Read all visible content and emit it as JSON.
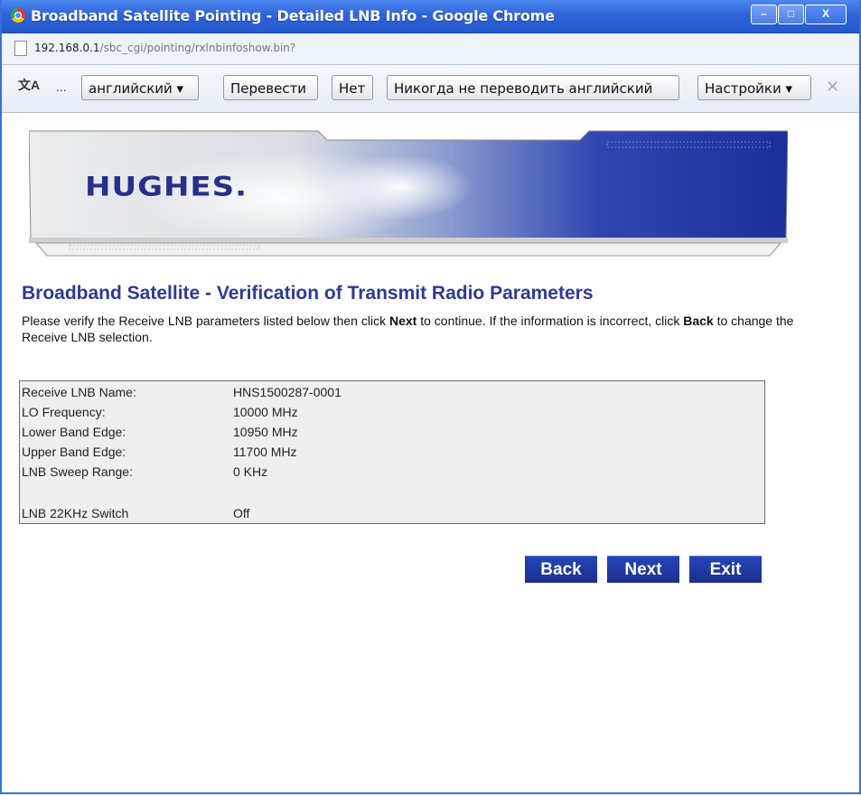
{
  "window": {
    "title": "Broadband Satellite Pointing - Detailed LNB Info - Google Chrome",
    "minimize_glyph": "–",
    "maximize_glyph": "□",
    "close_glyph": "X"
  },
  "address": {
    "host": "192.168.0.1",
    "path": "/sbc_cgi/pointing/rxlnbinfoshow.bin?"
  },
  "translate_bar": {
    "icon_text": "文A",
    "ellipsis": "...",
    "language_label": "английский ▾",
    "translate_label": "Перевести",
    "no_label": "Нет",
    "never_label": "Никогда не переводить английский",
    "settings_label": "Настройки ▾",
    "close_glyph": "✕"
  },
  "banner": {
    "logo_text": "HUGHES."
  },
  "page": {
    "title": "Broadband Satellite - Verification of Transmit Radio Parameters",
    "instructions": {
      "part1": "Please verify the Receive LNB parameters listed below then click ",
      "next_word": "Next",
      "part2": " to continue. If the information is incorrect, click ",
      "back_word": "Back",
      "part3": " to change the Receive LNB selection."
    }
  },
  "params": [
    {
      "label": "Receive LNB Name:",
      "value": "HNS1500287-0001"
    },
    {
      "label": "LO Frequency:",
      "value": "10000 MHz"
    },
    {
      "label": "Lower Band Edge:",
      "value": "10950 MHz"
    },
    {
      "label": "Upper Band Edge:",
      "value": "11700 MHz"
    },
    {
      "label": "LNB Sweep Range:",
      "value": "0 KHz"
    },
    {
      "label": "LNB 22KHz Switch",
      "value": "Off"
    }
  ],
  "buttons": {
    "back": "Back",
    "next": "Next",
    "exit": "Exit"
  },
  "colors": {
    "title_blue": "#2e3a94",
    "button_blue": "#1c2f8f",
    "titlebar_blue": "#2f63d8"
  }
}
